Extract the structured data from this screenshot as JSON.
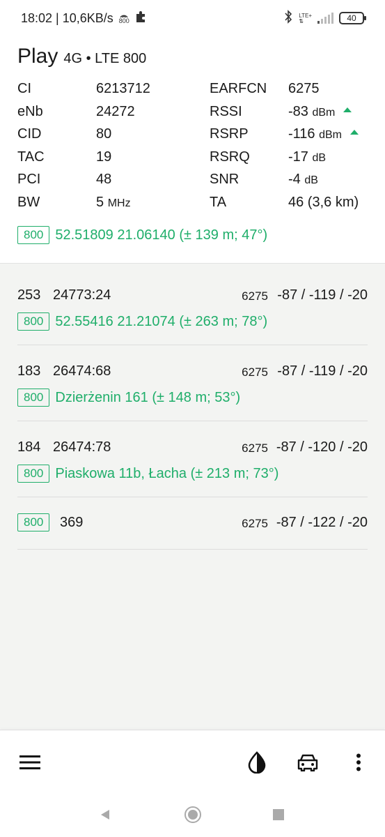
{
  "status_bar": {
    "time_speed": "18:02 | 10,6KB/s",
    "hotspot_label": "800",
    "lte_label": "LTE+",
    "battery": "40"
  },
  "header": {
    "operator": "Play",
    "tech": "4G • LTE 800"
  },
  "cell_info": {
    "rows": [
      {
        "k1": "CI",
        "v1": "6213712",
        "k2": "EARFCN",
        "v2": "6275",
        "u2": "",
        "arrow": false
      },
      {
        "k1": "eNb",
        "v1": "24272",
        "k2": "RSSI",
        "v2": "-83",
        "u2": "dBm",
        "arrow": true
      },
      {
        "k1": "CID",
        "v1": "80",
        "k2": "RSRP",
        "v2": "-116",
        "u2": "dBm",
        "arrow": true
      },
      {
        "k1": "TAC",
        "v1": "19",
        "k2": "RSRQ",
        "v2": "-17",
        "u2": "dB",
        "arrow": false
      },
      {
        "k1": "PCI",
        "v1": "48",
        "k2": "SNR",
        "v2": "-4",
        "u2": "dB",
        "arrow": false
      },
      {
        "k1": "BW",
        "v1": "5",
        "u1": "MHz",
        "k2": "TA",
        "v2": "46 (3,6 km)",
        "u2": "",
        "arrow": false
      }
    ],
    "band": "800",
    "location": "52.51809 21.06140 (± 139 m; 47°)"
  },
  "neighbors": [
    {
      "pci": "253",
      "cell": "24773:24",
      "earfcn": "6275",
      "values": "-87 / -119 / -20",
      "band": "800",
      "location": "52.55416 21.21074 (± 263 m; 78°)"
    },
    {
      "pci": "183",
      "cell": "26474:68",
      "earfcn": "6275",
      "values": "-87 / -119 / -20",
      "band": "800",
      "location": "Dzierżenin 161 (± 148 m; 53°)"
    },
    {
      "pci": "184",
      "cell": "26474:78",
      "earfcn": "6275",
      "values": "-87 / -120 / -20",
      "band": "800",
      "location": "Piaskowa 11b, Łacha (± 213 m; 73°)"
    },
    {
      "band": "800",
      "pci": "369",
      "earfcn": "6275",
      "values": "-87 / -122 / -20"
    }
  ],
  "toolbar": {
    "menu_icon": "hamburger-menu-icon",
    "theme_icon": "contrast-icon",
    "car_icon": "car-icon",
    "more_icon": "more-vertical-icon"
  },
  "colors": {
    "accent": "#1fae6a",
    "neighbors_bg": "#f3f4f2"
  }
}
